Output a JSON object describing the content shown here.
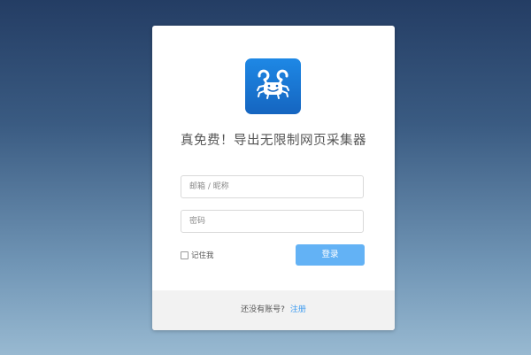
{
  "login": {
    "logo_icon": "crab-logo-icon",
    "title": "真免费！导出无限制网页采集器",
    "email_placeholder": "邮箱 / 昵称",
    "password_placeholder": "密码",
    "remember_label": "记住我",
    "submit_label": "登录"
  },
  "footer": {
    "no_account_text": "还没有账号?",
    "register_link": "注册"
  },
  "colors": {
    "accent": "#63b2f5",
    "link": "#3d9bf0",
    "logo_bg": "#1976d2"
  }
}
